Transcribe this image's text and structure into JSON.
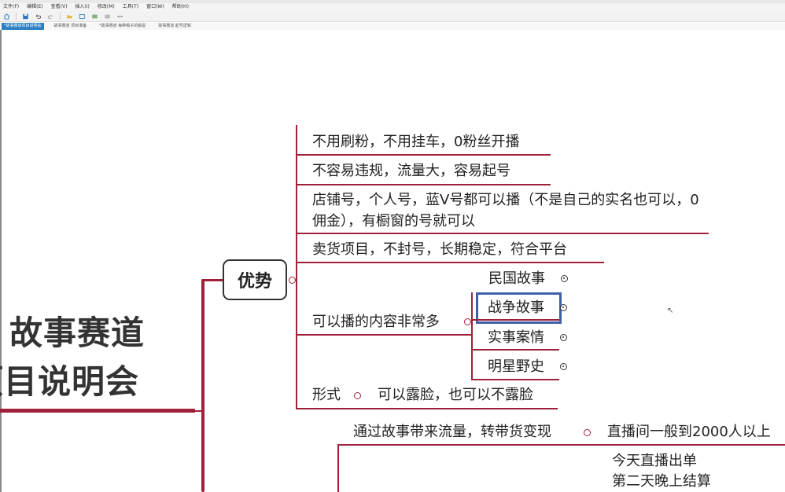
{
  "menu": [
    "文件(F)",
    "编辑(E)",
    "查看(V)",
    "插入(I)",
    "修改(M)",
    "工具(T)",
    "窗口(W)",
    "帮助(H)"
  ],
  "tabs": [
    "*故事赛道项目说明会",
    "故事赛道 项目准备",
    "*故事赛道 每种稿子的解说",
    "故事赛道 起号逻辑"
  ],
  "toolbar_icons": [
    "home-icon",
    "save-icon",
    "undo-icon",
    "redo-icon",
    "folder-icon",
    "export-icon",
    "image-icon",
    "outline-icon",
    "more-icon"
  ],
  "root": {
    "line1": "故事赛道",
    "line2": "项目说明会"
  },
  "main_node": {
    "label": "优势"
  },
  "branches": {
    "b1": "不用刷粉，不用挂车，0粉丝开播",
    "b2": "不容易违规，流量大，容易起号",
    "b3": "店铺号，个人号，蓝V号都可以播（不是自己的实名也可以，0佣金），有橱窗的号就可以",
    "b4": "卖货项目，不封号，长期稳定，符合平台",
    "b5": "可以播的内容非常多",
    "b6": "形式",
    "b6_child": "可以露脸，也可以不露脸"
  },
  "content_types": [
    "民国故事",
    "战争故事",
    "实事案情",
    "明星野史"
  ],
  "second_topic": {
    "label": "通过故事带来流量，转带货变现",
    "child": "直播间一般到2000人以上",
    "note1": "今天直播出单",
    "note2": "第二天晚上结算"
  },
  "colors": {
    "branch": "#a0203b",
    "selection": "#3d5fa8",
    "tab_active": "#2a7fc4"
  }
}
